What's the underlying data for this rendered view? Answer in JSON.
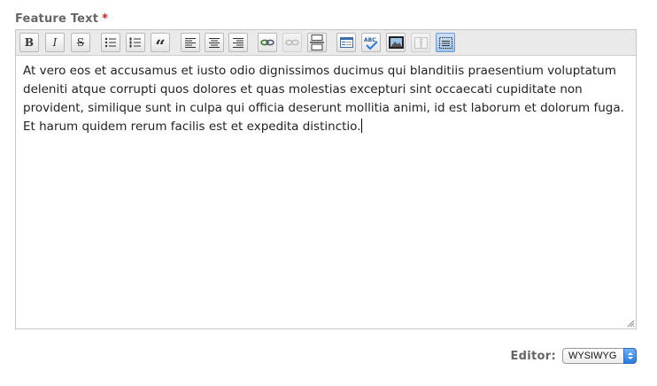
{
  "field": {
    "label": "Feature Text",
    "required_mark": "*"
  },
  "toolbar": {
    "bold": "B",
    "italic": "I",
    "strike": "S",
    "blockquote": "“"
  },
  "content": {
    "text": "At vero eos et accusamus et iusto odio dignissimos ducimus qui blanditiis praesentium voluptatum deleniti atque corrupti quos dolores et quas molestias excepturi sint occaecati cupiditate non provident, similique sunt in culpa qui officia deserunt mollitia animi, id est laborum et dolorum fuga. Et harum quidem rerum facilis est et expedita distinctio."
  },
  "editor_switch": {
    "label": "Editor:",
    "selected": "WYSIWYG"
  },
  "colors": {
    "label": "#666666",
    "required": "#cc2222",
    "toolbar_bg": "#eaeaea",
    "active_button": "#9fc3e8",
    "select_arrow": "#2a7be0"
  }
}
